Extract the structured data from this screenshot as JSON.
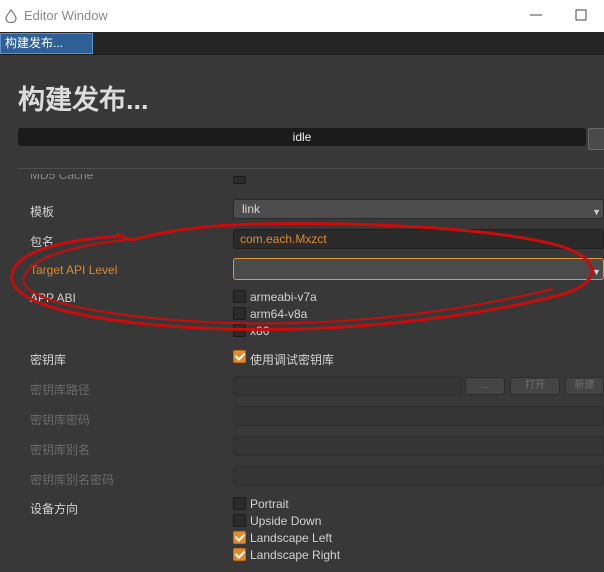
{
  "window": {
    "title": "Editor Window"
  },
  "tab": {
    "label": "构建发布..."
  },
  "header": {
    "title": "构建发布...",
    "status": "idle"
  },
  "form": {
    "partial_label": "MD5 Cache",
    "template_label": "模板",
    "template_value": "link",
    "package_label": "包名",
    "package_value": "com.each.Mxzct",
    "target_api_label": "Target API Level",
    "target_api_value": "",
    "app_abi_label": "APP ABI",
    "abi_options": [
      {
        "label": "armeabi-v7a",
        "checked": false
      },
      {
        "label": "arm64-v8a",
        "checked": false
      },
      {
        "label": "x86",
        "checked": false
      }
    ],
    "keystore_label": "密钥库",
    "use_debug_keystore_label": "使用调试密钥库",
    "use_debug_keystore_checked": true,
    "keystore_path_label": "密钥库路径",
    "browse_button": "...",
    "open_button": "打开",
    "new_button": "新建",
    "keystore_password_label": "密钥库密码",
    "alias_label": "密钥库别名",
    "alias_password_label": "密钥库别名密码",
    "orientation_label": "设备方向",
    "orientations": [
      {
        "label": "Portrait",
        "checked": false
      },
      {
        "label": "Upside Down",
        "checked": false
      },
      {
        "label": "Landscape Left",
        "checked": true
      },
      {
        "label": "Landscape Right",
        "checked": true
      }
    ]
  },
  "colors": {
    "accent": "#e48a2c",
    "tab_active": "#2f5f97",
    "annotation": "#d10c0c",
    "background": "#383838"
  }
}
